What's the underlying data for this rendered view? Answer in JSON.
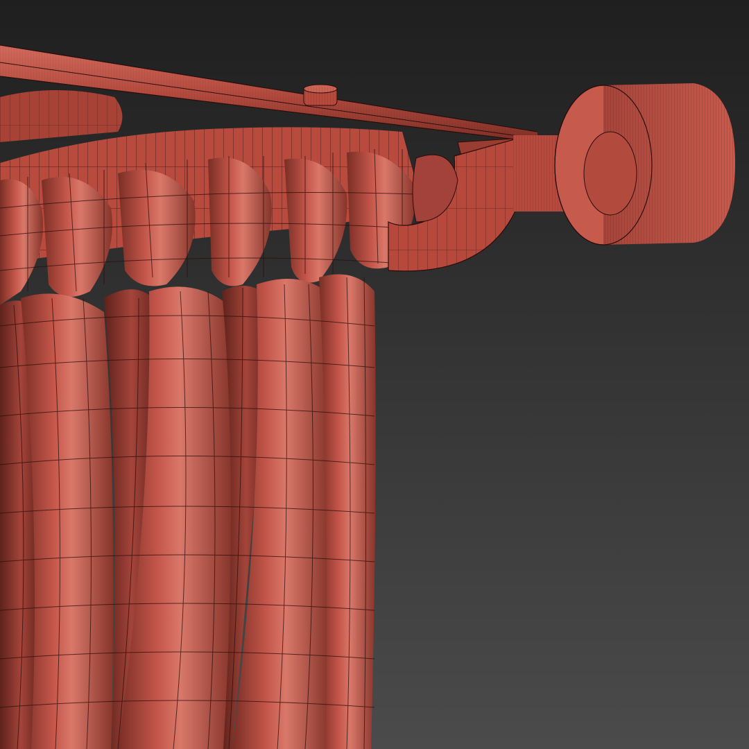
{
  "scene": {
    "subject": "curtain-rod-with-pleated-curtain-wireframe",
    "colors": {
      "background_top": "#1f1f1f",
      "background_bottom": "#4a4a4a",
      "material": "#b8473b",
      "material_light": "#d0685a",
      "material_dark": "#6e2a22",
      "wire": "#2a0d0a"
    }
  }
}
